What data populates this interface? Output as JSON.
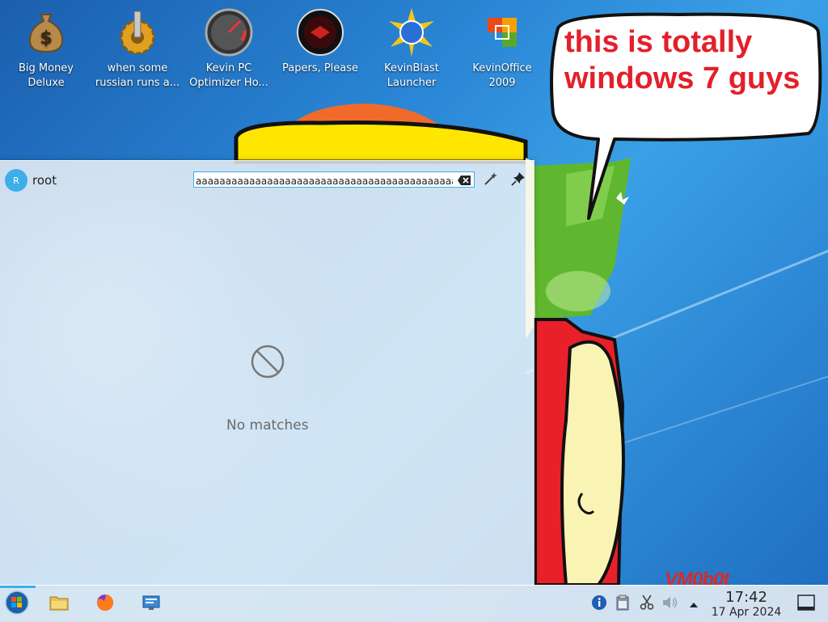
{
  "desktop": {
    "icons": [
      {
        "label": "Big Money\nDeluxe",
        "icon": "money-bag-icon"
      },
      {
        "label": "when some\nrussian runs a...",
        "icon": "gear-icon"
      },
      {
        "label": "Kevin PC\nOptimizer Ho...",
        "icon": "speedometer-icon"
      },
      {
        "label": "Papers, Please",
        "icon": "papers-please-icon"
      },
      {
        "label": "KevinBlast\nLauncher",
        "icon": "blast-globe-icon"
      },
      {
        "label": "KevinOffice\n2009",
        "icon": "office-icon"
      }
    ],
    "speech_bubble": "this is totally windows 7 guys",
    "watermark": "VM0b0t"
  },
  "launcher": {
    "avatar_initial": "R",
    "username": "root",
    "search": {
      "value": "aaaaaaaaaaaaaaaaaaaaaaaaaaaaaaaaaaaaaaaaaaaaaaaa",
      "placeholder": ""
    },
    "no_matches": "No matches"
  },
  "taskbar": {
    "buttons": [
      "start-orb-icon",
      "file-manager-icon",
      "firefox-icon",
      "remote-desktop-icon"
    ],
    "tray": [
      "info-icon",
      "clipboard-icon",
      "scissors-icon",
      "volume-icon",
      "tray-expand-icon"
    ],
    "clock": {
      "time": "17:42",
      "date": "17 Apr 2024"
    }
  }
}
